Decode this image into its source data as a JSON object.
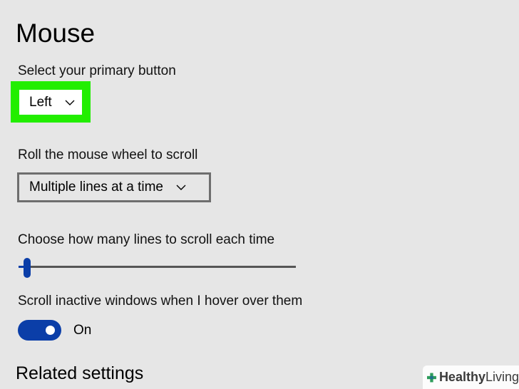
{
  "page": {
    "title": "Mouse"
  },
  "primary_button": {
    "label": "Select your primary button",
    "value": "Left",
    "highlight_color": "#22ee00"
  },
  "scroll_wheel": {
    "label": "Roll the mouse wheel to scroll",
    "value": "Multiple lines at a time"
  },
  "lines_slider": {
    "label": "Choose how many lines to scroll each time",
    "level_fraction": 0.03
  },
  "inactive_scroll": {
    "label": "Scroll inactive windows when I hover over them",
    "state": "On",
    "accent_color": "#0b3ea8"
  },
  "related": {
    "title": "Related settings"
  },
  "watermark": {
    "brand_1": "Healthy",
    "brand_2": "Living",
    "icon": "plus-cross-icon"
  }
}
